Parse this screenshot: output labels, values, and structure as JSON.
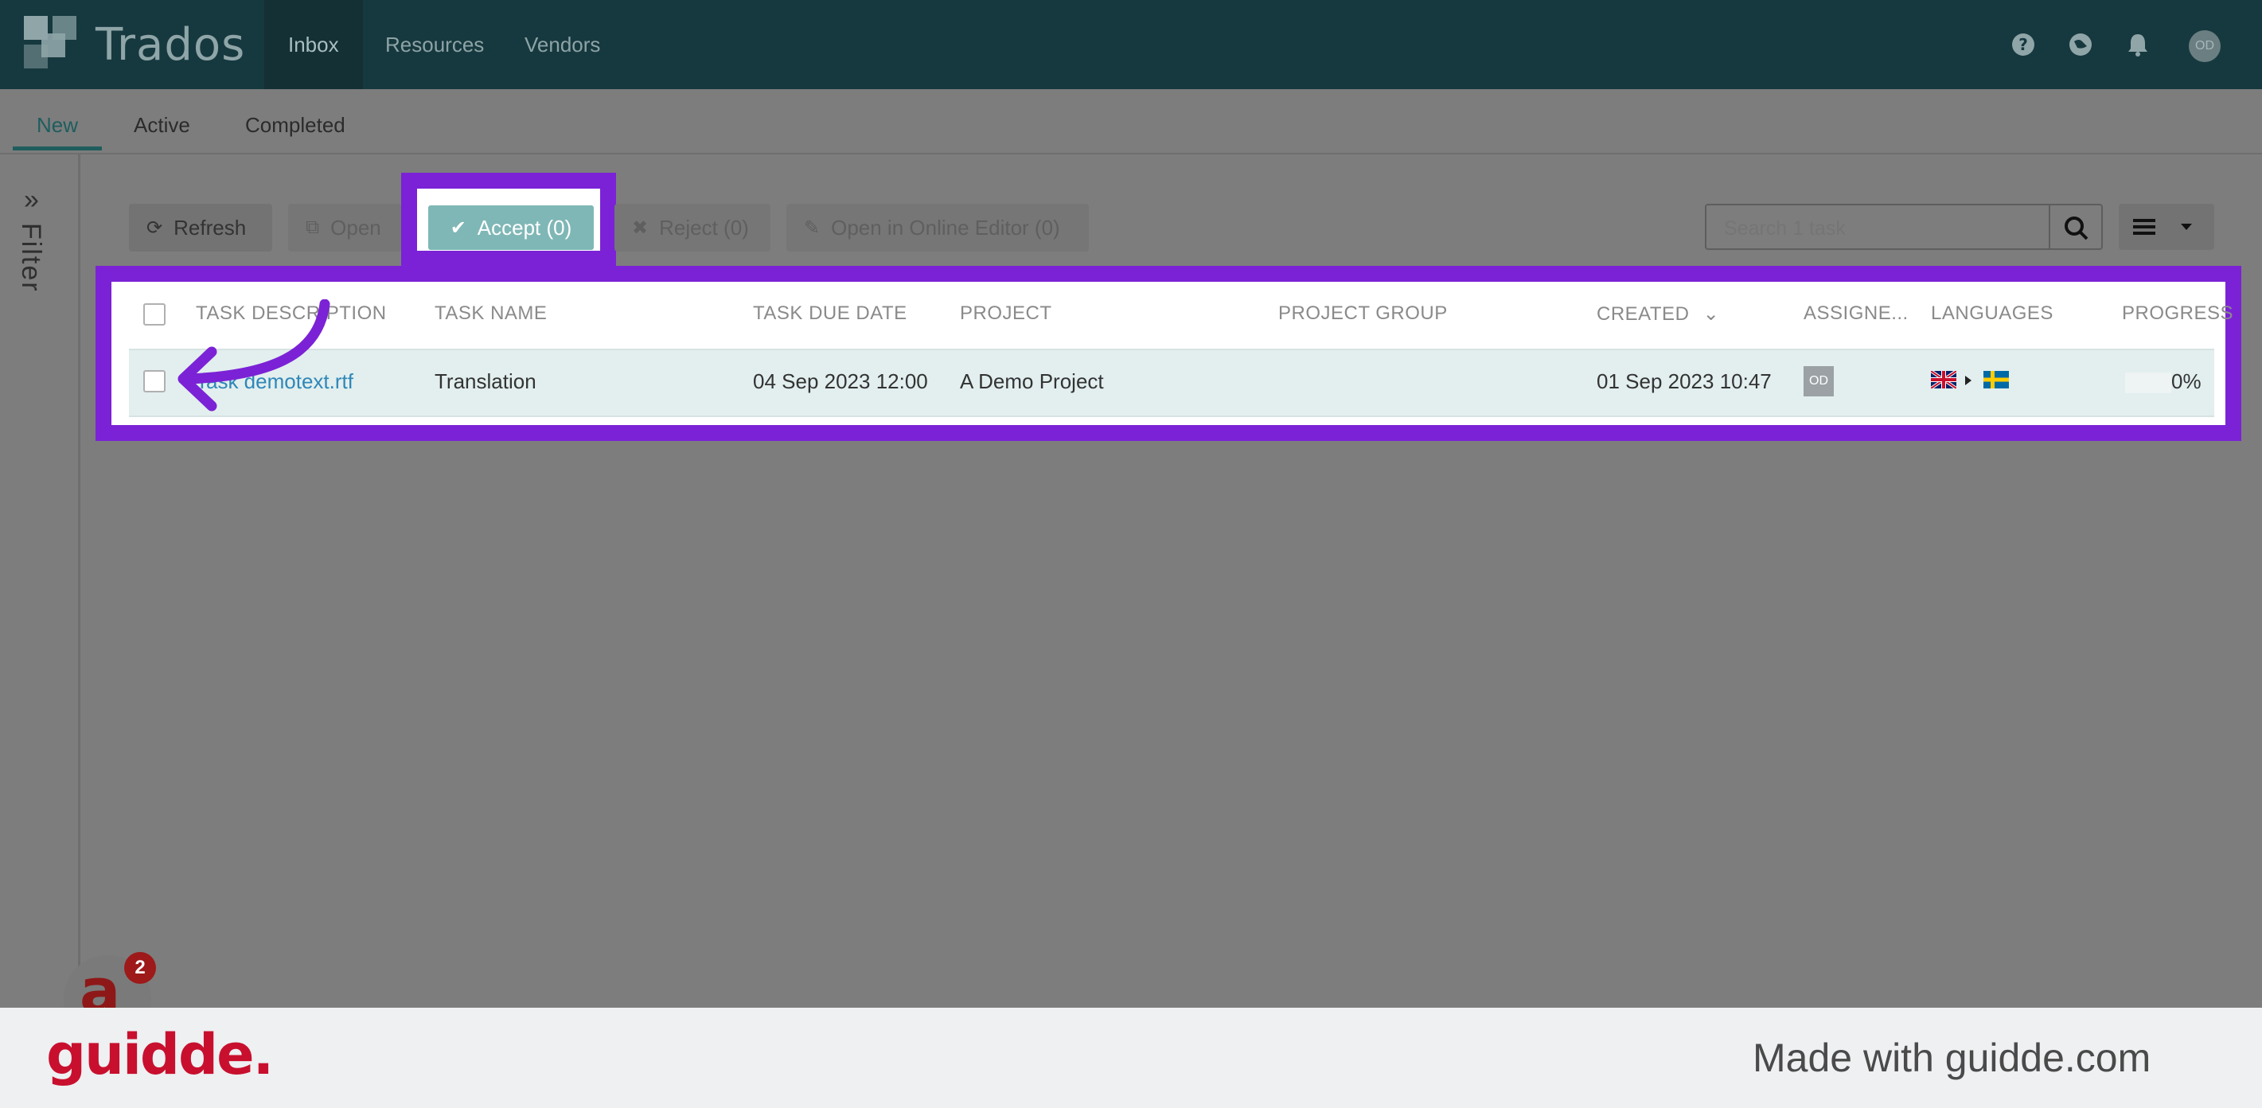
{
  "app": {
    "title": "Trados"
  },
  "nav": {
    "items": [
      {
        "label": "Inbox",
        "active": true
      },
      {
        "label": "Resources"
      },
      {
        "label": "Vendors"
      }
    ]
  },
  "header_icons": [
    "help-icon",
    "globe-icon",
    "bell-icon"
  ],
  "user": {
    "initials": "OD"
  },
  "subtabs": [
    {
      "label": "New",
      "active": true
    },
    {
      "label": "Active"
    },
    {
      "label": "Completed"
    }
  ],
  "filter": {
    "label": "Filter"
  },
  "toolbar": {
    "refresh_label": "Refresh",
    "open_label": "Open",
    "accept_label": "Accept (0)",
    "reject_label": "Reject (0)",
    "online_editor_label": "Open in Online Editor (0)"
  },
  "search": {
    "placeholder": "Search 1 task"
  },
  "table": {
    "columns": [
      "TASK DESCRIPTION",
      "TASK NAME",
      "TASK DUE DATE",
      "PROJECT",
      "PROJECT GROUP",
      "CREATED",
      "ASSIGNE...",
      "LANGUAGES",
      "PROGRESS"
    ],
    "rows": [
      {
        "description": "Task demotext.rtf",
        "task_name": "Translation",
        "due_date": "04 Sep 2023 12:00",
        "project": "A Demo Project",
        "project_group": "",
        "created": "01 Sep 2023 10:47",
        "assignee": "OD",
        "source_lang": "en-GB",
        "target_lang": "sv-SE",
        "progress": "0%"
      }
    ]
  },
  "footer": {
    "brand": "guidde.",
    "made_with": "Made with guidde.com"
  },
  "widget": {
    "badge_count": "2",
    "letter": "a"
  },
  "colors": {
    "header": "#16393f",
    "accent": "#1f5d5e",
    "highlight": "#7b22d6",
    "guidde_red": "#c8102e"
  }
}
